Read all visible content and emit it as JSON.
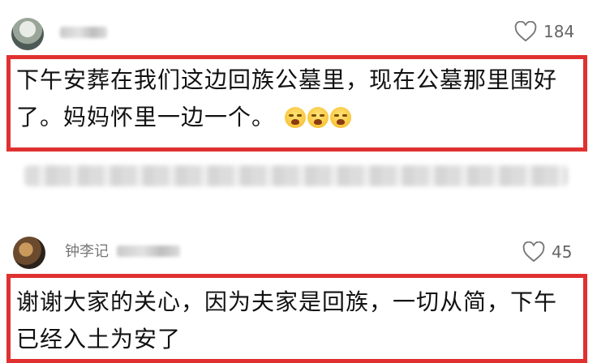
{
  "comments": [
    {
      "likes": "184",
      "text": "下午安葬在我们这边回族公墓里，现在公墓那里围好了。妈妈怀里一边一个。",
      "emoji": "crying-face"
    },
    {
      "username": "钟李记",
      "likes": "45",
      "text": "谢谢大家的关心，因为夫家是回族，一切从简，下午已经入土为安了"
    }
  ],
  "colors": {
    "highlight": "#e03131",
    "text": "#111111",
    "meta": "#777777"
  }
}
